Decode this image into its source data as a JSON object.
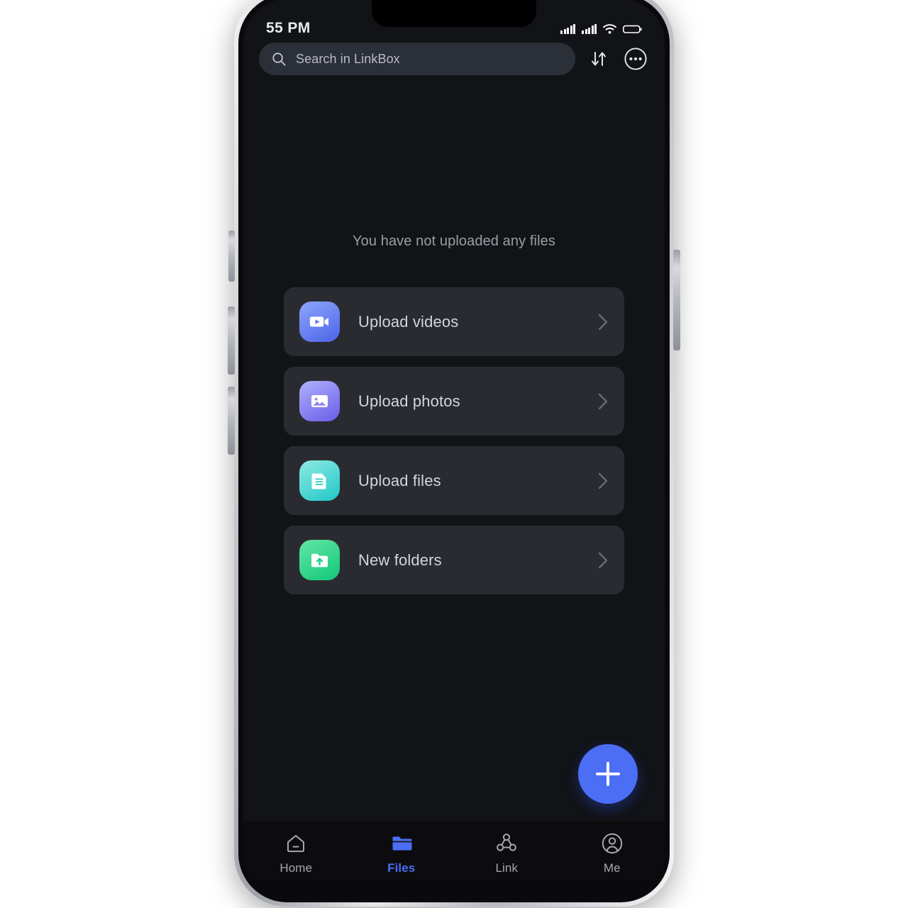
{
  "statusbar": {
    "time": "55 PM",
    "signal1_icon": "cellular-signal-icon",
    "signal2_icon": "cellular-signal-icon",
    "wifi_icon": "wifi-icon",
    "battery_icon": "battery-icon"
  },
  "header": {
    "search": {
      "placeholder": "Search in LinkBox",
      "icon": "search-icon"
    },
    "sort_icon": "sort-arrows-icon",
    "more_icon": "more-options-icon"
  },
  "main": {
    "empty_message": "You have not uploaded any files",
    "cards": [
      {
        "label": "Upload videos",
        "icon": "video-camera-icon",
        "color_from": "#8ea6fb",
        "color_to": "#4b63e8"
      },
      {
        "label": "Upload photos",
        "icon": "photo-image-icon",
        "color_from": "#aeb1fb",
        "color_to": "#6b5ce8"
      },
      {
        "label": "Upload files",
        "icon": "document-icon",
        "color_from": "#8fe9e2",
        "color_to": "#1fc7c7"
      },
      {
        "label": "New folders",
        "icon": "folder-upload-icon",
        "color_from": "#63e6a4",
        "color_to": "#12c77a"
      }
    ],
    "fab": {
      "label": "+",
      "icon": "plus-icon",
      "color": "#4b6ef5"
    }
  },
  "tabbar": {
    "active_color": "#4b6ef5",
    "tabs": [
      {
        "label": "Home",
        "icon": "home-icon",
        "active": false
      },
      {
        "label": "Files",
        "icon": "folder-icon",
        "active": true
      },
      {
        "label": "Link",
        "icon": "share-nodes-icon",
        "active": false
      },
      {
        "label": "Me",
        "icon": "user-circle-icon",
        "active": false
      }
    ]
  }
}
